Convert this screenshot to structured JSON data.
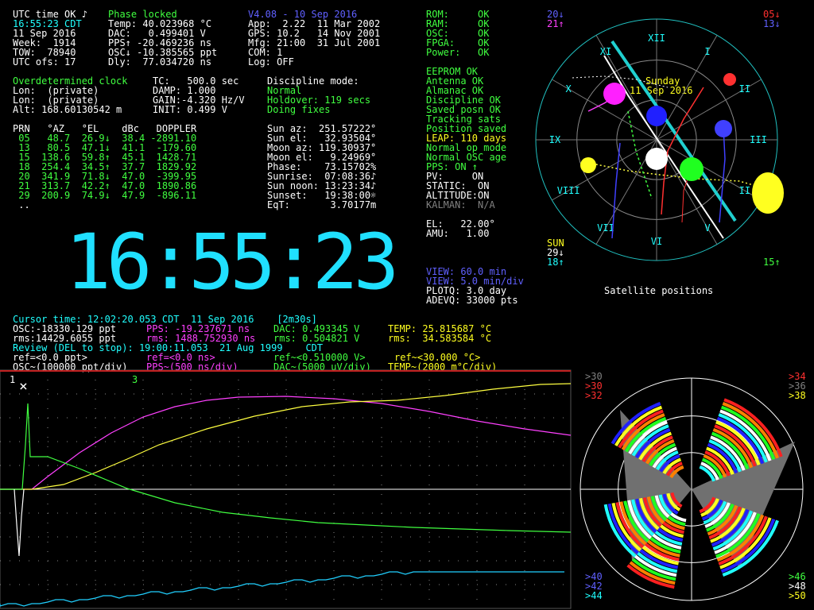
{
  "status": {
    "utc_status": "UTC time OK",
    "note_icon": "music-note-icon",
    "phase": "Phase locked",
    "version": "V4.08 - 10 Sep 2016",
    "time_line": "16:55:23 CDT",
    "date_line": "11 Sep 2016",
    "week_line": "Week:  1914",
    "tow_line": "TOW:  78940",
    "utcofs_line": "UTC ofs: 17",
    "temp": "Temp: 40.023968 °C",
    "dac": "DAC:   0.499401 V",
    "pps": "PPS↑ -20.469236 ns",
    "osc": "OSC↓ -10.385565 ppt",
    "dly": "Dly:  77.034720 ns",
    "app": "App:  2.22  11 Mar 2002",
    "gps": "GPS: 10.2   14 Nov 2001",
    "mfg": "Mfg: 21:00  31 Jul 2001",
    "com": "COM: 1",
    "log": "Log: OFF"
  },
  "health": {
    "rom": {
      "label": "ROM:",
      "value": "OK"
    },
    "ram": {
      "label": "RAM:",
      "value": "OK"
    },
    "osc": {
      "label": "OSC:",
      "value": "OK"
    },
    "fpga": {
      "label": "FPGA:",
      "value": "OK"
    },
    "power": {
      "label": "Power:",
      "value": "OK"
    }
  },
  "clock": {
    "mode": "Overdetermined clock",
    "lon1": "Lon:  (private)",
    "lon2": "Lon:  (private)",
    "alt": "Alt: 168.60130542 m",
    "tc": "TC:   500.0 sec",
    "damp": "DAMP: 1.000",
    "gain": "GAIN:-4.320 Hz/V",
    "init": "INIT: 0.499 V",
    "discipline_label": "Discipline mode:",
    "discipline_mode": "Normal",
    "holdover": "Holdover: 119 secs",
    "doing_fixes": "Doing fixes"
  },
  "status_list": [
    {
      "text": "EEPROM OK",
      "color": "#40ff40"
    },
    {
      "text": "Antenna OK",
      "color": "#40ff40"
    },
    {
      "text": "Almanac OK",
      "color": "#40ff40"
    },
    {
      "text": "Discipline OK",
      "color": "#40ff40"
    },
    {
      "text": "Saved posn OK",
      "color": "#40ff40"
    },
    {
      "text": "Tracking sats",
      "color": "#40ff40"
    },
    {
      "text": "Position saved",
      "color": "#40ff40"
    },
    {
      "text": "LEAP: 110 days",
      "color": "#ffff20"
    },
    {
      "text": "Normal op mode",
      "color": "#40ff40"
    },
    {
      "text": "Normal OSC age",
      "color": "#40ff40"
    },
    {
      "text": "PPS: ON ↑",
      "color": "#40ff40"
    }
  ],
  "settings": {
    "pv": "PV:     ON",
    "static": "STATIC:  ON",
    "altitude": "ALTITUDE:ON",
    "kalman": "KALMAN:  N/A",
    "el": "EL:   22.00°",
    "amu": "AMU:   1.00"
  },
  "sat_table": {
    "header": "PRN   °AZ   °EL    dBc   DOPPLER",
    "rows": [
      " 05   48.7  26.9↓  38.4 -2891.10",
      " 13   80.5  47.1↓  41.1  -179.60",
      " 15  138.6  59.8↑  45.1  1428.71",
      " 18  254.4  34.5↑  37.7  1829.92",
      " 20  341.9  71.8↓  47.0  -399.95",
      " 21  313.7  42.2↑  47.0  1890.86",
      " 29  200.9  74.9↓  47.9  -896.11"
    ],
    "more": " .."
  },
  "sun_moon": [
    "Sun az:  251.57222°",
    "Sun el:   32.93504°",
    "Moon az: 119.30937°",
    "Moon el:   9.24969°",
    "Phase:    73.15702%",
    "Sunrise:  07:08:36♪",
    "Sun noon: 13:23:34♪",
    "Sunset:   19:38:00☼",
    "EqT:       3.70177m"
  ],
  "big_clock": "16:55:23",
  "view": {
    "view1": "VIEW: 60.0 min",
    "view2": "VIEW: 5.0 min/div",
    "plotq": "PLOTQ: 3.0 day",
    "adevq": "ADEVQ: 33000 pts"
  },
  "sky": {
    "title": "Satellite positions",
    "day": "Sunday",
    "date": "11 Sep 2016",
    "corner_tl1": "20↓",
    "corner_tl2": "21↑",
    "corner_tr1": "05↓",
    "corner_tr2": "13↓",
    "sun_label": "SUN",
    "bl1": "29↓",
    "bl2": "18↑",
    "br": "15↑",
    "hours": [
      "XII",
      "I",
      "II",
      "III",
      "II",
      "V",
      "VI",
      "VII",
      "VIII",
      "IX",
      "X",
      "XI"
    ]
  },
  "cursor": {
    "line1": "Cursor time: 12:02:20.053 CDT  11 Sep 2016    [2m30s]",
    "osc": "OSC:-18330.129 ppt",
    "pps": "PPS: -19.237671 ns",
    "dac": "DAC: 0.493345 V",
    "temp": "TEMP: 25.815687 °C",
    "rms1": "rms:14429.6055 ppt",
    "rms2": "rms: 1488.752930 ns",
    "rms3": "rms: 0.504821 V",
    "rms4": "rms:  34.583584 °C",
    "review": "Review (DEL to stop): 19:00:11.053  21 Aug 1999    CDT",
    "ref1": "ref=<0.0 ppt>",
    "ref2": "ref=<0.0 ns>",
    "ref3": "ref~<0.510000 V>",
    "ref4": "ref~<30.000 °C>",
    "scale1": "OSC~(100000 ppt/div)",
    "scale2": "PPS~(500 ns/div)",
    "scale3": "DAC~(5000 uV/div)",
    "scale4": "TEMP~(2000 m°C/div)"
  },
  "polar": {
    "tl": [
      ">30",
      ">30",
      ">32"
    ],
    "tr": [
      ">34",
      ">36",
      ">38"
    ],
    "bl": [
      ">40",
      ">42",
      ">44"
    ],
    "br": [
      ">46",
      ">48",
      ">50"
    ]
  },
  "graph_markers": {
    "m1": "1",
    "m3": "3",
    "close": "close-icon"
  }
}
